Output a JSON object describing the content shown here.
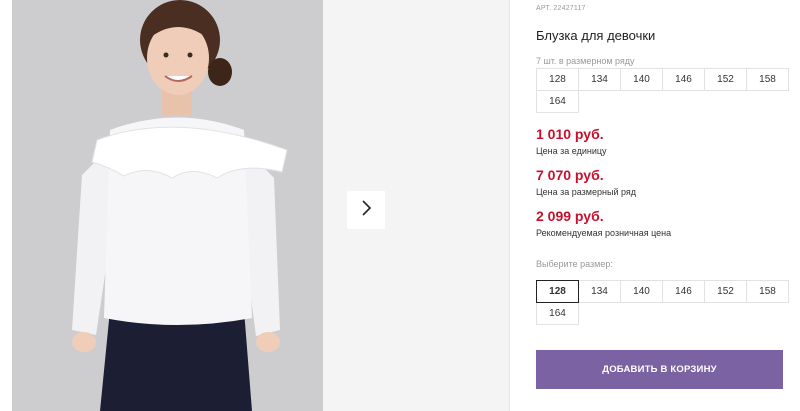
{
  "product": {
    "article": "АРТ. 22427117",
    "title": "Блузка для девочки"
  },
  "row_sizes": {
    "hint": "7 шт. в размерном ряду",
    "sizes": [
      "128",
      "134",
      "140",
      "146",
      "152",
      "158",
      "164"
    ]
  },
  "prices": [
    {
      "value": "1 010 руб.",
      "label": "Цена за единицу"
    },
    {
      "value": "7 070 руб.",
      "label": "Цена за размерный ряд"
    },
    {
      "value": "2 099 руб.",
      "label": "Рекомендуемая розничная цена"
    }
  ],
  "size_select": {
    "hint": "Выберите размер:",
    "sizes": [
      "128",
      "134",
      "140",
      "146",
      "152",
      "158",
      "164"
    ],
    "selected": "128"
  },
  "cart_button": {
    "label": "ДОБАВИТЬ В КОРЗИНУ"
  },
  "colors": {
    "price": "#c8102e",
    "button": "#7b62a3"
  },
  "icons": {
    "next": "chevron-right-icon"
  }
}
